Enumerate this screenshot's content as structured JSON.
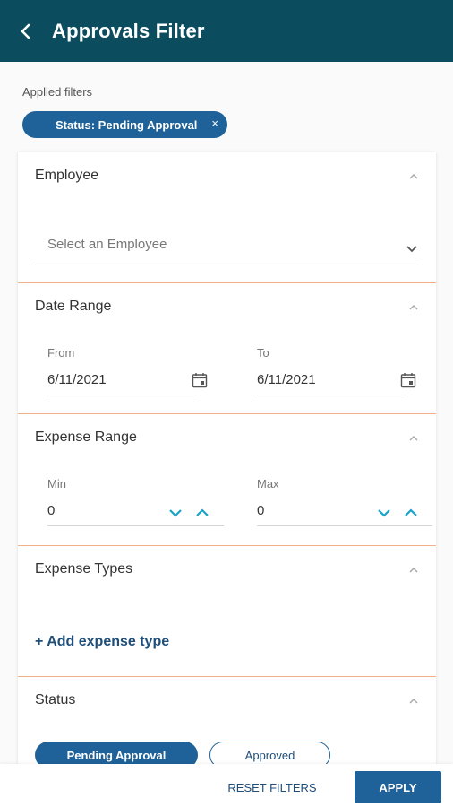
{
  "header": {
    "title": "Approvals Filter",
    "back_icon": "chevron-left-icon"
  },
  "applied": {
    "label": "Applied filters",
    "chip_label": "Status: Pending Approval",
    "chip_close": "×"
  },
  "employee": {
    "title": "Employee",
    "placeholder": "Select an Employee"
  },
  "date_range": {
    "title": "Date Range",
    "from_label": "From",
    "from_value": "6/11/2021",
    "to_label": "To",
    "to_value": "6/11/2021"
  },
  "expense_range": {
    "title": "Expense Range",
    "min_label": "Min",
    "min_value": "0",
    "max_label": "Max",
    "max_value": "0"
  },
  "expense_types": {
    "title": "Expense Types",
    "add_label": "+ Add expense type"
  },
  "status": {
    "title": "Status",
    "options": [
      "Pending Approval",
      "Approved"
    ],
    "selected": "Pending Approval"
  },
  "footer": {
    "reset_label": "RESET FILTERS",
    "apply_label": "APPLY"
  },
  "colors": {
    "header_bg": "#0b4d5e",
    "primary": "#1f6299",
    "accent_divider": "#f0b08a",
    "stepper": "#1aa3c9"
  }
}
